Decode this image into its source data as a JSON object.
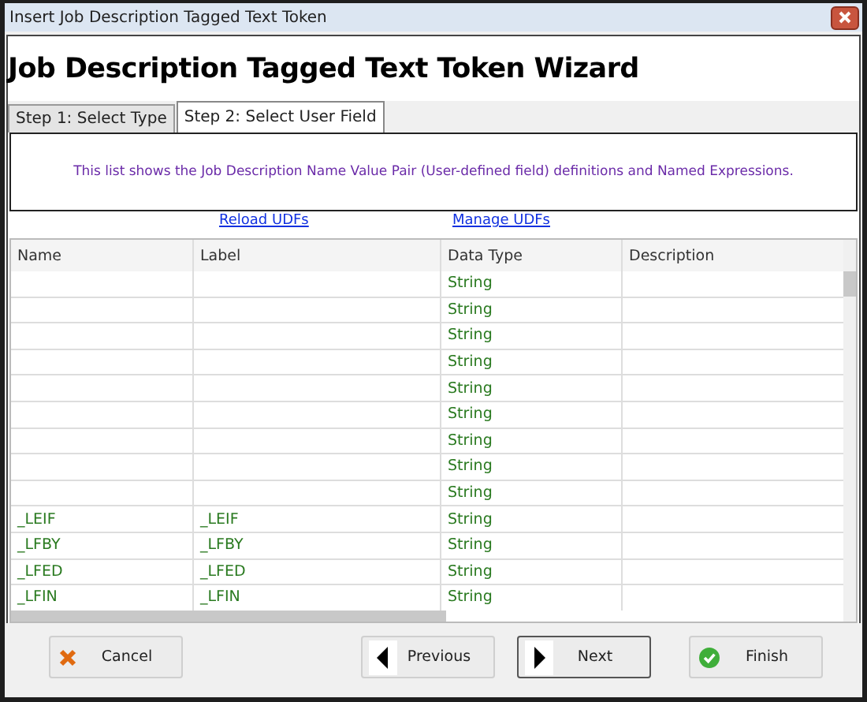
{
  "window": {
    "title": "Insert Job Description Tagged Text Token"
  },
  "heading": "Job Description Tagged Text Token Wizard",
  "tabs": [
    {
      "label": "Step 1: Select Type",
      "selected": false
    },
    {
      "label": "Step 2: Select User Field",
      "selected": true
    }
  ],
  "info": "This list shows the Job Description Name Value Pair (User-defined field) definitions and Named Expressions.",
  "links": [
    "Reload UDFs",
    "Manage UDFs"
  ],
  "table": {
    "columns": [
      "Name",
      "Label",
      "Data Type",
      "Description"
    ],
    "rows": [
      {
        "data_type": "String"
      },
      {
        "data_type": "String"
      },
      {
        "data_type": "String"
      },
      {
        "data_type": "String"
      },
      {
        "data_type": "String"
      },
      {
        "data_type": "String"
      },
      {
        "data_type": "String"
      },
      {
        "data_type": "String"
      },
      {
        "data_type": "String"
      },
      {
        "name": "_LEIF",
        "label": "_LEIF",
        "data_type": "String"
      },
      {
        "name": "_LFBY",
        "label": "_LFBY",
        "data_type": "String"
      },
      {
        "name": "_LFED",
        "label": "_LFED",
        "data_type": "String"
      },
      {
        "name": "_LFIN",
        "label": "_LFIN",
        "data_type": "String"
      }
    ]
  },
  "buttons": [
    {
      "label": "Cancel",
      "kind": "cancel",
      "focused": false
    },
    {
      "label": "Previous",
      "kind": "previous",
      "focused": false
    },
    {
      "label": "Next",
      "kind": "next",
      "focused": true
    },
    {
      "label": "Finish",
      "kind": "finish",
      "focused": false
    }
  ]
}
